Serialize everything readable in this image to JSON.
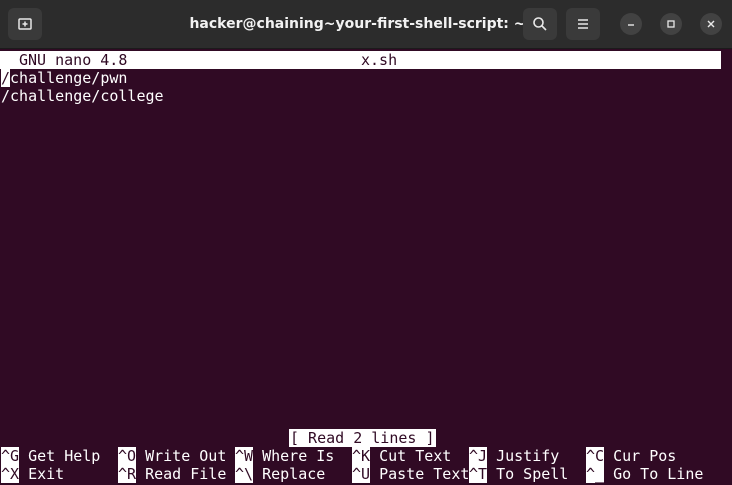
{
  "window": {
    "title": "hacker@chaining~your-first-shell-script: ~",
    "buttons": {
      "new_tab_icon": "new-tab-icon",
      "search_icon": "search-icon",
      "menu_icon": "hamburger-menu-icon"
    }
  },
  "nano": {
    "version": "GNU nano 4.8",
    "filename": "x.sh",
    "lines": [
      "/challenge/pwn",
      "/challenge/college"
    ],
    "cursor_char": "/",
    "line1_rest": "challenge/pwn",
    "status": "[ Read 2 lines ]"
  },
  "shortcuts": {
    "row1": [
      {
        "key": "^G",
        "label": "Get Help"
      },
      {
        "key": "^O",
        "label": "Write Out"
      },
      {
        "key": "^W",
        "label": "Where Is"
      },
      {
        "key": "^K",
        "label": "Cut Text"
      },
      {
        "key": "^J",
        "label": "Justify"
      },
      {
        "key": "^C",
        "label": "Cur Pos"
      }
    ],
    "row2": [
      {
        "key": "^X",
        "label": "Exit"
      },
      {
        "key": "^R",
        "label": "Read File"
      },
      {
        "key": "^\\",
        "label": "Replace"
      },
      {
        "key": "^U",
        "label": "Paste Text"
      },
      {
        "key": "^T",
        "label": "To Spell"
      },
      {
        "key": "^_",
        "label": "Go To Line"
      }
    ]
  },
  "colors": {
    "terminal_bg": "#300a24",
    "titlebar_bg": "#2c2c2c",
    "text": "#ffffff"
  }
}
